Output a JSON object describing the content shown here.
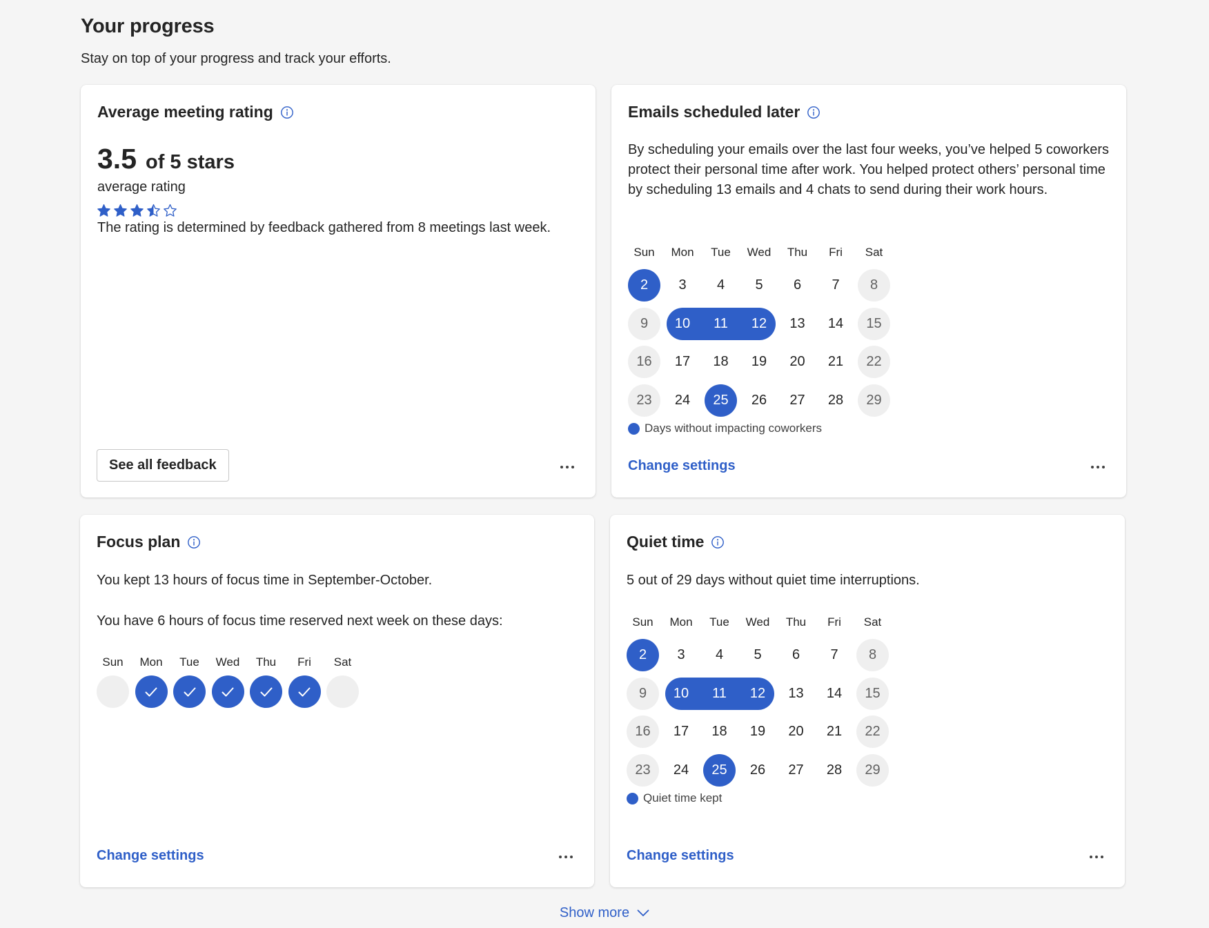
{
  "header": {
    "title": "Your progress",
    "subtitle": "Stay on top of your progress and track your efforts."
  },
  "colors": {
    "accent": "#2f5fc8",
    "weekend_bg": "#efefef",
    "card_bg": "#ffffff",
    "page_bg": "#f5f5f5"
  },
  "rating_card": {
    "title": "Average meeting rating",
    "info_icon": "info-icon",
    "value": "3.5",
    "of_text": "of 5 stars",
    "caption": "average rating",
    "stars_rating": 3.5,
    "stars_max": 5,
    "description": "The rating is determined by feedback gathered from 8 meetings last week.",
    "button_label": "See all feedback",
    "more_icon": "more-horizontal-icon"
  },
  "emails_card": {
    "title": "Emails scheduled later",
    "info_icon": "info-icon",
    "description": "By scheduling your emails over the last four weeks, you’ve helped  5 coworkers protect their personal time after work. You helped protect others’ personal time by scheduling 13 emails and 4 chats to send during their work hours.",
    "calendar": {
      "days_of_week": [
        "Sun",
        "Mon",
        "Tue",
        "Wed",
        "Thu",
        "Fri",
        "Sat"
      ],
      "weeks": [
        [
          "2",
          "3",
          "4",
          "5",
          "6",
          "7",
          "8"
        ],
        [
          "9",
          "10",
          "11",
          "12",
          "13",
          "14",
          "15"
        ],
        [
          "16",
          "17",
          "18",
          "19",
          "20",
          "21",
          "22"
        ],
        [
          "23",
          "24",
          "25",
          "26",
          "27",
          "28",
          "29"
        ]
      ],
      "highlighted_days": [
        "2",
        "10",
        "11",
        "12",
        "25"
      ]
    },
    "legend": "Days without impacting coworkers",
    "link_label": "Change settings",
    "more_icon": "more-horizontal-icon"
  },
  "focus_card": {
    "title": "Focus plan",
    "info_icon": "info-icon",
    "line1": "You kept 13 hours of focus time in September-October.",
    "line2": "You have 6 hours of focus time reserved next week on these days:",
    "week": [
      {
        "day": "Sun",
        "reserved": false
      },
      {
        "day": "Mon",
        "reserved": true
      },
      {
        "day": "Tue",
        "reserved": true
      },
      {
        "day": "Wed",
        "reserved": true
      },
      {
        "day": "Thu",
        "reserved": true
      },
      {
        "day": "Fri",
        "reserved": true
      },
      {
        "day": "Sat",
        "reserved": false
      }
    ],
    "check_icon": "checkmark-icon",
    "link_label": "Change settings",
    "more_icon": "more-horizontal-icon"
  },
  "quiet_card": {
    "title": "Quiet time",
    "info_icon": "info-icon",
    "description": "5 out of 29 days without quiet time interruptions.",
    "calendar": {
      "days_of_week": [
        "Sun",
        "Mon",
        "Tue",
        "Wed",
        "Thu",
        "Fri",
        "Sat"
      ],
      "weeks": [
        [
          "2",
          "3",
          "4",
          "5",
          "6",
          "7",
          "8"
        ],
        [
          "9",
          "10",
          "11",
          "12",
          "13",
          "14",
          "15"
        ],
        [
          "16",
          "17",
          "18",
          "19",
          "20",
          "21",
          "22"
        ],
        [
          "23",
          "24",
          "25",
          "26",
          "27",
          "28",
          "29"
        ]
      ],
      "highlighted_days": [
        "2",
        "10",
        "11",
        "12",
        "25"
      ]
    },
    "legend": "Quiet time kept",
    "link_label": "Change settings",
    "more_icon": "more-horizontal-icon"
  },
  "footer": {
    "show_more_label": "Show more",
    "chevron_icon": "chevron-down-icon"
  }
}
